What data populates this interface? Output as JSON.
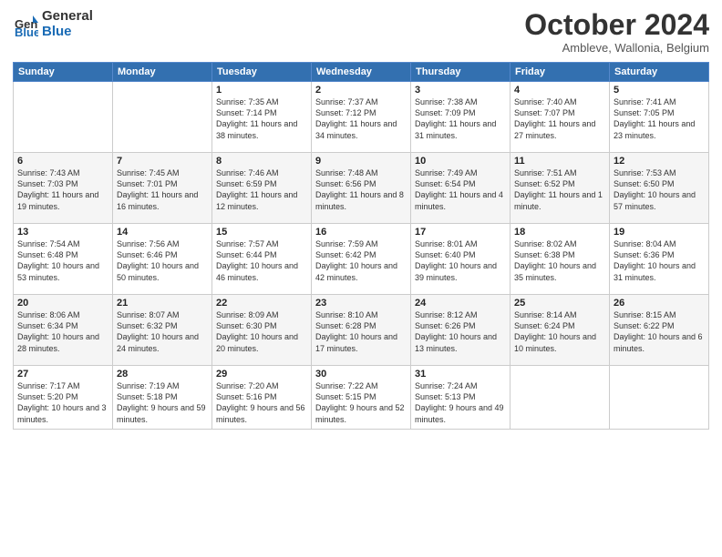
{
  "logo": {
    "general": "General",
    "blue": "Blue"
  },
  "header": {
    "month": "October 2024",
    "location": "Ambleve, Wallonia, Belgium"
  },
  "weekdays": [
    "Sunday",
    "Monday",
    "Tuesday",
    "Wednesday",
    "Thursday",
    "Friday",
    "Saturday"
  ],
  "weeks": [
    [
      {
        "day": "",
        "content": ""
      },
      {
        "day": "",
        "content": ""
      },
      {
        "day": "1",
        "content": "Sunrise: 7:35 AM\nSunset: 7:14 PM\nDaylight: 11 hours and 38 minutes."
      },
      {
        "day": "2",
        "content": "Sunrise: 7:37 AM\nSunset: 7:12 PM\nDaylight: 11 hours and 34 minutes."
      },
      {
        "day": "3",
        "content": "Sunrise: 7:38 AM\nSunset: 7:09 PM\nDaylight: 11 hours and 31 minutes."
      },
      {
        "day": "4",
        "content": "Sunrise: 7:40 AM\nSunset: 7:07 PM\nDaylight: 11 hours and 27 minutes."
      },
      {
        "day": "5",
        "content": "Sunrise: 7:41 AM\nSunset: 7:05 PM\nDaylight: 11 hours and 23 minutes."
      }
    ],
    [
      {
        "day": "6",
        "content": "Sunrise: 7:43 AM\nSunset: 7:03 PM\nDaylight: 11 hours and 19 minutes."
      },
      {
        "day": "7",
        "content": "Sunrise: 7:45 AM\nSunset: 7:01 PM\nDaylight: 11 hours and 16 minutes."
      },
      {
        "day": "8",
        "content": "Sunrise: 7:46 AM\nSunset: 6:59 PM\nDaylight: 11 hours and 12 minutes."
      },
      {
        "day": "9",
        "content": "Sunrise: 7:48 AM\nSunset: 6:56 PM\nDaylight: 11 hours and 8 minutes."
      },
      {
        "day": "10",
        "content": "Sunrise: 7:49 AM\nSunset: 6:54 PM\nDaylight: 11 hours and 4 minutes."
      },
      {
        "day": "11",
        "content": "Sunrise: 7:51 AM\nSunset: 6:52 PM\nDaylight: 11 hours and 1 minute."
      },
      {
        "day": "12",
        "content": "Sunrise: 7:53 AM\nSunset: 6:50 PM\nDaylight: 10 hours and 57 minutes."
      }
    ],
    [
      {
        "day": "13",
        "content": "Sunrise: 7:54 AM\nSunset: 6:48 PM\nDaylight: 10 hours and 53 minutes."
      },
      {
        "day": "14",
        "content": "Sunrise: 7:56 AM\nSunset: 6:46 PM\nDaylight: 10 hours and 50 minutes."
      },
      {
        "day": "15",
        "content": "Sunrise: 7:57 AM\nSunset: 6:44 PM\nDaylight: 10 hours and 46 minutes."
      },
      {
        "day": "16",
        "content": "Sunrise: 7:59 AM\nSunset: 6:42 PM\nDaylight: 10 hours and 42 minutes."
      },
      {
        "day": "17",
        "content": "Sunrise: 8:01 AM\nSunset: 6:40 PM\nDaylight: 10 hours and 39 minutes."
      },
      {
        "day": "18",
        "content": "Sunrise: 8:02 AM\nSunset: 6:38 PM\nDaylight: 10 hours and 35 minutes."
      },
      {
        "day": "19",
        "content": "Sunrise: 8:04 AM\nSunset: 6:36 PM\nDaylight: 10 hours and 31 minutes."
      }
    ],
    [
      {
        "day": "20",
        "content": "Sunrise: 8:06 AM\nSunset: 6:34 PM\nDaylight: 10 hours and 28 minutes."
      },
      {
        "day": "21",
        "content": "Sunrise: 8:07 AM\nSunset: 6:32 PM\nDaylight: 10 hours and 24 minutes."
      },
      {
        "day": "22",
        "content": "Sunrise: 8:09 AM\nSunset: 6:30 PM\nDaylight: 10 hours and 20 minutes."
      },
      {
        "day": "23",
        "content": "Sunrise: 8:10 AM\nSunset: 6:28 PM\nDaylight: 10 hours and 17 minutes."
      },
      {
        "day": "24",
        "content": "Sunrise: 8:12 AM\nSunset: 6:26 PM\nDaylight: 10 hours and 13 minutes."
      },
      {
        "day": "25",
        "content": "Sunrise: 8:14 AM\nSunset: 6:24 PM\nDaylight: 10 hours and 10 minutes."
      },
      {
        "day": "26",
        "content": "Sunrise: 8:15 AM\nSunset: 6:22 PM\nDaylight: 10 hours and 6 minutes."
      }
    ],
    [
      {
        "day": "27",
        "content": "Sunrise: 7:17 AM\nSunset: 5:20 PM\nDaylight: 10 hours and 3 minutes."
      },
      {
        "day": "28",
        "content": "Sunrise: 7:19 AM\nSunset: 5:18 PM\nDaylight: 9 hours and 59 minutes."
      },
      {
        "day": "29",
        "content": "Sunrise: 7:20 AM\nSunset: 5:16 PM\nDaylight: 9 hours and 56 minutes."
      },
      {
        "day": "30",
        "content": "Sunrise: 7:22 AM\nSunset: 5:15 PM\nDaylight: 9 hours and 52 minutes."
      },
      {
        "day": "31",
        "content": "Sunrise: 7:24 AM\nSunset: 5:13 PM\nDaylight: 9 hours and 49 minutes."
      },
      {
        "day": "",
        "content": ""
      },
      {
        "day": "",
        "content": ""
      }
    ]
  ]
}
